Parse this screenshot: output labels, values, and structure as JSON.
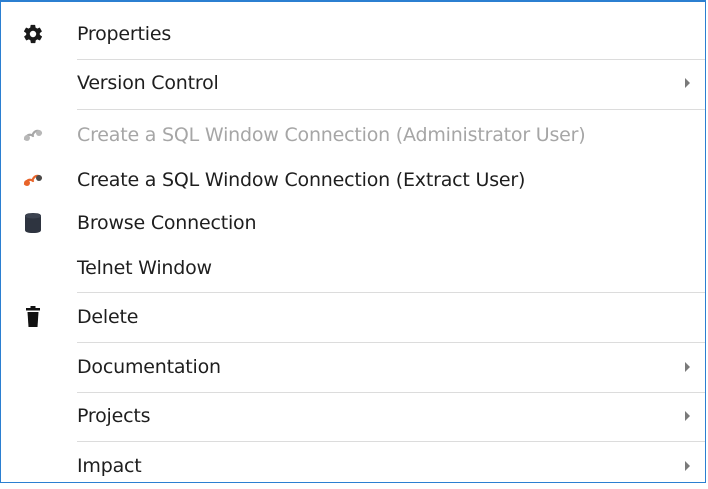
{
  "menu": {
    "items": [
      {
        "label": "Properties",
        "icon": "gear-icon",
        "disabled": false,
        "submenu": false
      },
      {
        "label": "Version Control",
        "icon": "",
        "disabled": false,
        "submenu": true
      },
      {
        "label": "Create a SQL Window Connection (Administrator User)",
        "icon": "sql-connection-icon",
        "disabled": true,
        "submenu": false
      },
      {
        "label": "Create a SQL Window Connection (Extract User)",
        "icon": "sql-connection-icon",
        "disabled": false,
        "submenu": false
      },
      {
        "label": "Browse Connection",
        "icon": "database-icon",
        "disabled": false,
        "submenu": false
      },
      {
        "label": "Telnet Window",
        "icon": "",
        "disabled": false,
        "submenu": false
      },
      {
        "label": "Delete",
        "icon": "trash-icon",
        "disabled": false,
        "submenu": false
      },
      {
        "label": "Documentation",
        "icon": "",
        "disabled": false,
        "submenu": true
      },
      {
        "label": "Projects",
        "icon": "",
        "disabled": false,
        "submenu": true
      },
      {
        "label": "Impact",
        "icon": "",
        "disabled": false,
        "submenu": true
      }
    ]
  },
  "colors": {
    "border": "#2b7fd1",
    "text": "#1e1e1e",
    "disabled_text": "#a6a6a6",
    "separator": "#dcdcdc",
    "arrow": "#7a7a7a",
    "connection_orange": "#e8642a"
  }
}
